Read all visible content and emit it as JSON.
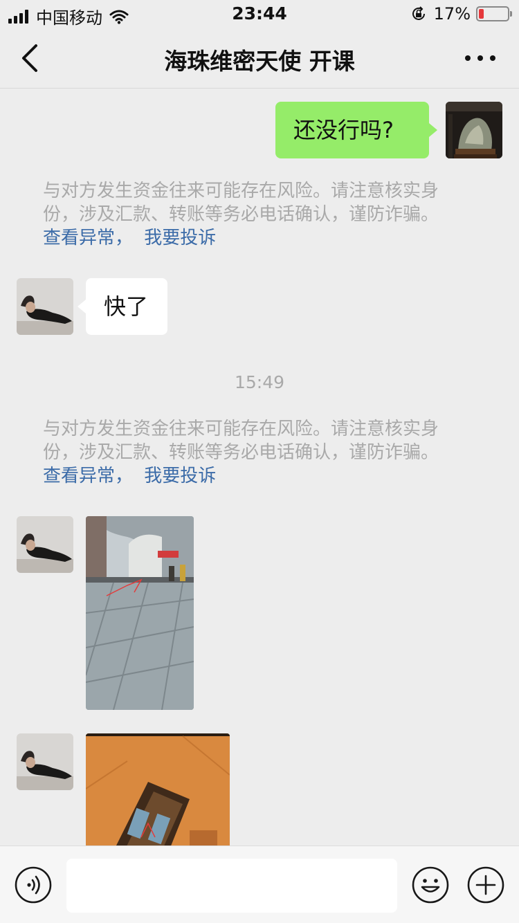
{
  "status_bar": {
    "carrier": "中国移动",
    "time": "23:44",
    "battery_percent": "17%",
    "battery_level": 0.17,
    "icons": [
      "signal-icon",
      "wifi-icon",
      "orientation-lock-icon",
      "battery-icon"
    ]
  },
  "nav": {
    "title": "海珠维密天使 开课",
    "back_icon": "chevron-left-icon",
    "more_icon": "more-dots-icon"
  },
  "messages": [
    {
      "type": "sent",
      "text": "还没行吗?"
    },
    {
      "type": "notice",
      "line1": "与对方发生资金往来可能存在风险。请注意核实身",
      "line2": "份，涉及汇款、转账等务必电话确认，谨防诈骗。",
      "link1": "查看异常，",
      "link2": "我要投诉"
    },
    {
      "type": "received",
      "text": "快了"
    },
    {
      "type": "timestamp",
      "text": "15:49"
    },
    {
      "type": "notice",
      "line1": "与对方发生资金往来可能存在风险。请注意核实身",
      "line2": "份，涉及汇款、转账等务必电话确认，谨防诈骗。",
      "link1": "查看异常，",
      "link2": "我要投诉"
    },
    {
      "type": "received_image",
      "description": "street-photo"
    },
    {
      "type": "received_image",
      "description": "floor-tile-photo"
    }
  ],
  "input_bar": {
    "placeholder": "",
    "icons": [
      "voice-icon",
      "emoji-icon",
      "plus-icon"
    ]
  },
  "colors": {
    "sent_bubble": "#95ec69",
    "background": "#ededed",
    "link": "#3b6ba8",
    "notice_text": "#a9a9a9",
    "battery_low": "#e5383b"
  }
}
